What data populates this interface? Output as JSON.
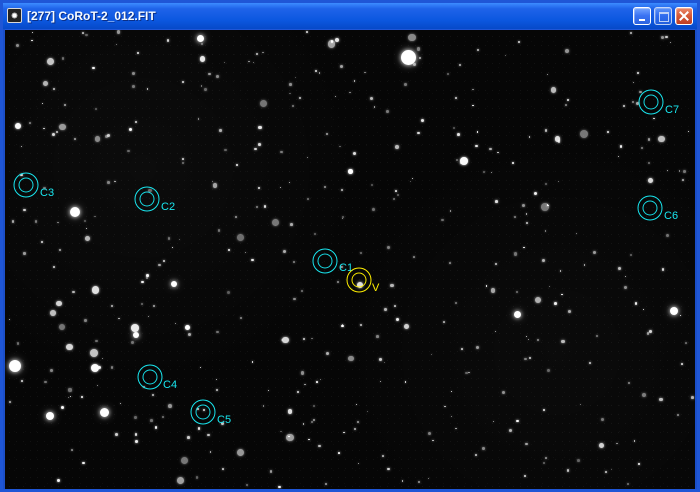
{
  "window": {
    "title": "[277] CoRoT-2_012.FIT",
    "icon": "astronomy-image-icon"
  },
  "controls": {
    "minimize_icon": "minimize-icon",
    "maximize_icon": "maximize-icon",
    "close_icon": "close-icon"
  },
  "colors": {
    "comparison_aperture": "#19e6ef",
    "variable_aperture": "#ffef00",
    "background": "#060606",
    "title_bar": "#0c58e0"
  },
  "apertures": [
    {
      "label": "C1",
      "type": "comparison"
    },
    {
      "label": "V",
      "type": "variable"
    },
    {
      "label": "C2",
      "type": "comparison"
    },
    {
      "label": "C3",
      "type": "comparison"
    },
    {
      "label": "C4",
      "type": "comparison"
    },
    {
      "label": "C5",
      "type": "comparison"
    },
    {
      "label": "C6",
      "type": "comparison"
    },
    {
      "label": "C7",
      "type": "comparison"
    }
  ]
}
